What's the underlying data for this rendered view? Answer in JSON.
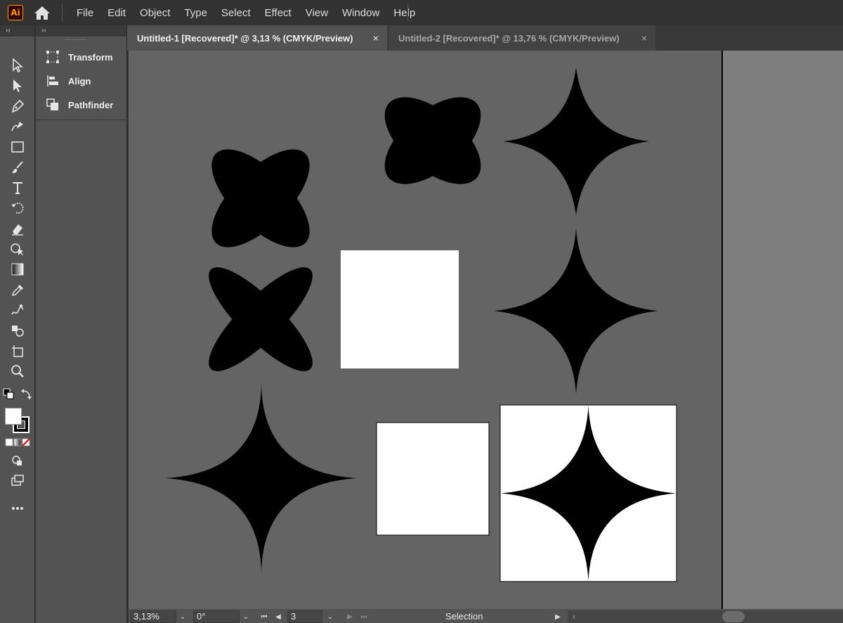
{
  "app": {
    "logo_text": "Ai",
    "accent": "#ff9a00"
  },
  "menu": [
    "File",
    "Edit",
    "Object",
    "Type",
    "Select",
    "Effect",
    "View",
    "Window",
    "Help"
  ],
  "toolbar": {
    "collapse": "››"
  },
  "panels": {
    "collapse": "››",
    "items": [
      "Transform",
      "Align",
      "Pathfinder"
    ]
  },
  "tabs": [
    {
      "label": "Untitled-1 [Recovered]* @ 3,13 % (CMYK/Preview)",
      "close": "×",
      "active": true
    },
    {
      "label": "Untitled-2 [Recovered]* @ 13,76 % (CMYK/Preview)",
      "close": "×",
      "active": false
    }
  ],
  "status": {
    "zoom": "3,13%",
    "rotation": "0°",
    "artboard": "3",
    "tool": "Selection"
  },
  "colors": {
    "fill": "#ffffff",
    "stroke": "#000000",
    "canvas": "#646464"
  }
}
